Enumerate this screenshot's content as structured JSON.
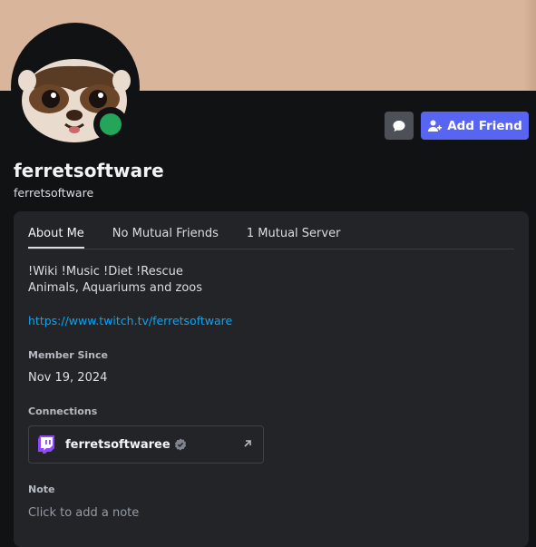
{
  "profile": {
    "display_name": "ferretsoftware",
    "username": "ferretsoftware",
    "status": "online",
    "status_color": "#23a55a",
    "banner_color": "#d9b59c"
  },
  "actions": {
    "message_icon": "chat-bubble-icon",
    "add_friend_label": "Add Friend",
    "add_friend_icon": "person-add-icon"
  },
  "tabs": [
    {
      "label": "About Me",
      "active": true
    },
    {
      "label": "No Mutual Friends",
      "active": false
    },
    {
      "label": "1 Mutual Server",
      "active": false
    }
  ],
  "about": {
    "bio_line1": "!Wiki !Music !Diet !Rescue",
    "bio_line2": "Animals, Aquariums and zoos",
    "link": "https://www.twitch.tv/ferretsoftware"
  },
  "member_since": {
    "label": "Member Since",
    "value": "Nov 19, 2024"
  },
  "connections": {
    "label": "Connections",
    "items": [
      {
        "platform_icon": "twitch-icon",
        "name": "ferretsoftwaree",
        "verified": true
      }
    ]
  },
  "note": {
    "label": "Note",
    "placeholder": "Click to add a note"
  }
}
